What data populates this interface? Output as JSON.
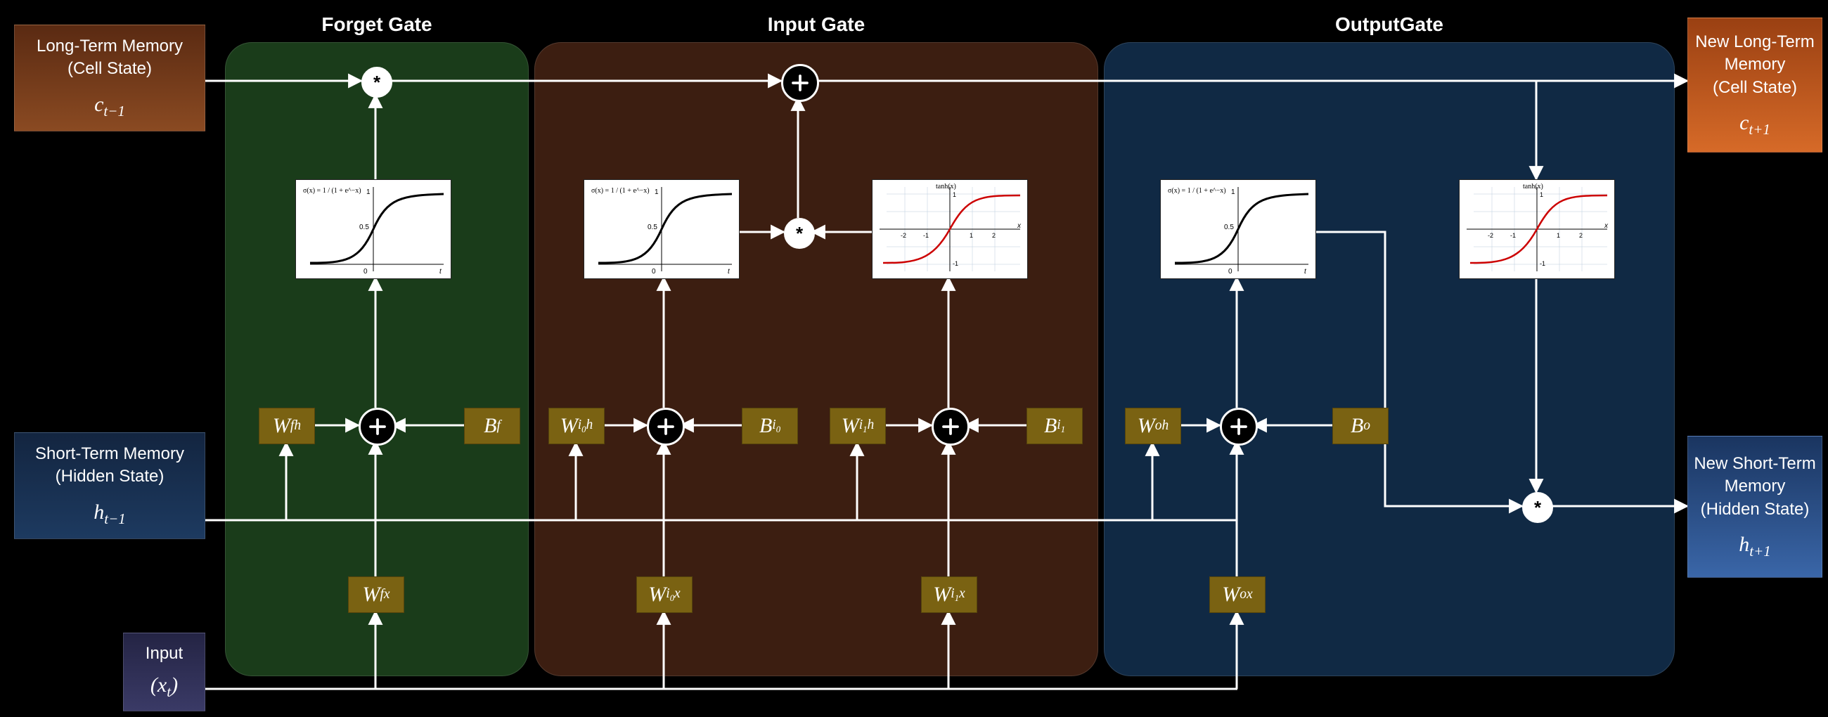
{
  "gates": {
    "forget": {
      "title": "Forget Gate"
    },
    "input": {
      "title": "Input Gate"
    },
    "output": {
      "title": "OutputGate"
    }
  },
  "boxes": {
    "ltm_in": {
      "line1": "Long-Term Memory",
      "line2": "(Cell State)",
      "sym": "c",
      "sub": "t−1"
    },
    "ltm_out": {
      "line1": "New Long-Term",
      "line2": "Memory",
      "line3": "(Cell State)",
      "sym": "c",
      "sub": "t+1"
    },
    "stm_in": {
      "line1": "Short-Term Memory",
      "line2": "(Hidden State)",
      "sym": "h",
      "sub": "t−1"
    },
    "stm_out": {
      "line1": "New Short-Term",
      "line2": "Memory",
      "line3": "(Hidden State)",
      "sym": "h",
      "sub": "t+1"
    },
    "input": {
      "line1": "Input",
      "sym": "(x",
      "sub": "t",
      "close": ")"
    }
  },
  "weights": {
    "f": {
      "Wfh": "W_fh",
      "Wfx": "W_fx",
      "Bf": "B_f"
    },
    "i0": {
      "Wi0h": "W_i0h",
      "Wi0x": "W_i0x",
      "Bi0": "B_i0"
    },
    "i1": {
      "Wi1h": "W_i1h",
      "Wi1x": "W_i1x",
      "Bi1": "B_i1"
    },
    "o": {
      "Woh": "W_oh",
      "Wox": "W_ox",
      "Bo": "B_o"
    }
  },
  "formulas": {
    "sigmoid": "σ(x) = 1 / (1 + e^−x)",
    "tanh": "tanh(x)"
  },
  "chart_data": [
    {
      "type": "line",
      "name": "sigmoid",
      "title": "σ(x) = 1/(1+e^-x)",
      "xlim": [
        -6,
        6
      ],
      "ylim": [
        0,
        1
      ],
      "yticks": [
        0,
        0.5,
        1
      ],
      "x": [
        -6,
        -4,
        -2,
        -1,
        0,
        1,
        2,
        4,
        6
      ],
      "y": [
        0.0025,
        0.018,
        0.119,
        0.269,
        0.5,
        0.731,
        0.881,
        0.982,
        0.9975
      ]
    },
    {
      "type": "line",
      "name": "tanh",
      "title": "tanh(x)",
      "xlim": [
        -3,
        3
      ],
      "ylim": [
        -1,
        1
      ],
      "xticks": [
        -2,
        -1,
        1,
        2
      ],
      "yticks": [
        -1,
        1
      ],
      "x": [
        -3,
        -2,
        -1,
        -0.5,
        0,
        0.5,
        1,
        2,
        3
      ],
      "y": [
        -0.995,
        -0.964,
        -0.762,
        -0.462,
        0,
        0.462,
        0.762,
        0.964,
        0.995
      ]
    }
  ]
}
